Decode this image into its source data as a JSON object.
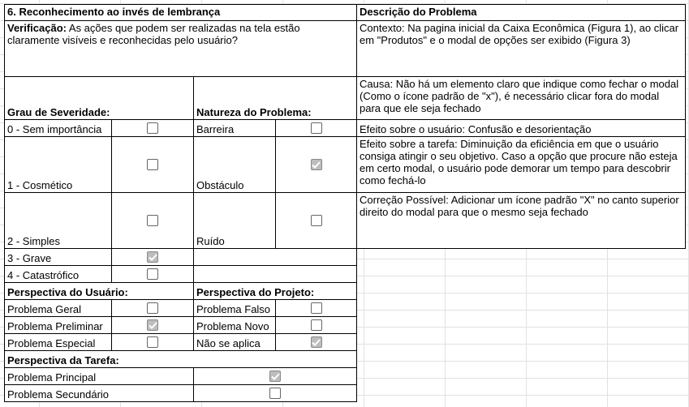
{
  "section": {
    "title": "6. Reconhecimento ao invés de lembrança",
    "verification_label": "Verificação:",
    "verification_text": " As ações que podem ser realizadas na tela estão claramente visíveis e reconhecidas pelo usuário?"
  },
  "severity": {
    "header": "Grau de Severidade:",
    "items": [
      "0 - Sem importância",
      "1 - Cosmético",
      "2 - Simples",
      "3 - Grave",
      "4 - Catastrófico"
    ],
    "checked": [
      false,
      false,
      false,
      true,
      false
    ]
  },
  "nature": {
    "header": "Natureza do Problema:",
    "items": [
      "Barreira",
      "Obstáculo",
      "Ruído"
    ],
    "checked": [
      false,
      true,
      false
    ]
  },
  "user_perspective": {
    "header": "Perspectiva do Usuário:",
    "items": [
      "Problema Geral",
      "Problema Preliminar",
      "Problema Especial"
    ],
    "checked": [
      false,
      true,
      false
    ]
  },
  "project_perspective": {
    "header": "Perspectiva do Projeto:",
    "items": [
      "Problema Falso",
      "Problema Novo",
      "Não se aplica"
    ],
    "checked": [
      false,
      false,
      true
    ]
  },
  "task_perspective": {
    "header": "Perspectiva da Tarefa:",
    "items": [
      "Problema Principal",
      "Problema Secundário"
    ],
    "checked": [
      true,
      false
    ]
  },
  "description": {
    "header": "Descrição do Problema",
    "context": "Contexto: Na pagina inicial da Caixa Econômica (Figura 1), ao clicar em \"Produtos\" e o modal de opções ser exibido (Figura 3)",
    "cause": "Causa: Não há um elemento claro que indique como fechar o modal (Como o ícone padrão de \"x\"), é necessário clicar fora do modal para que ele seja fechado",
    "effect_user": "Efeito sobre o usuário: Confusão e desorientação",
    "effect_task": "Efeito sobre a tarefa: Diminuição da eficiência em que o usuário consiga atingir o seu objetivo. Caso a opção que procure não esteja em certo modal, o usuário pode demorar um tempo para descobrir como fechá-lo",
    "correction": "Correção Possível: Adicionar um ícone padrão \"X\" no canto superior direito do modal para que o mesmo seja fechado"
  },
  "colors": {
    "checked_fill": "#bdbdbd",
    "gridline": "#e2e2e2",
    "border": "#000000"
  }
}
